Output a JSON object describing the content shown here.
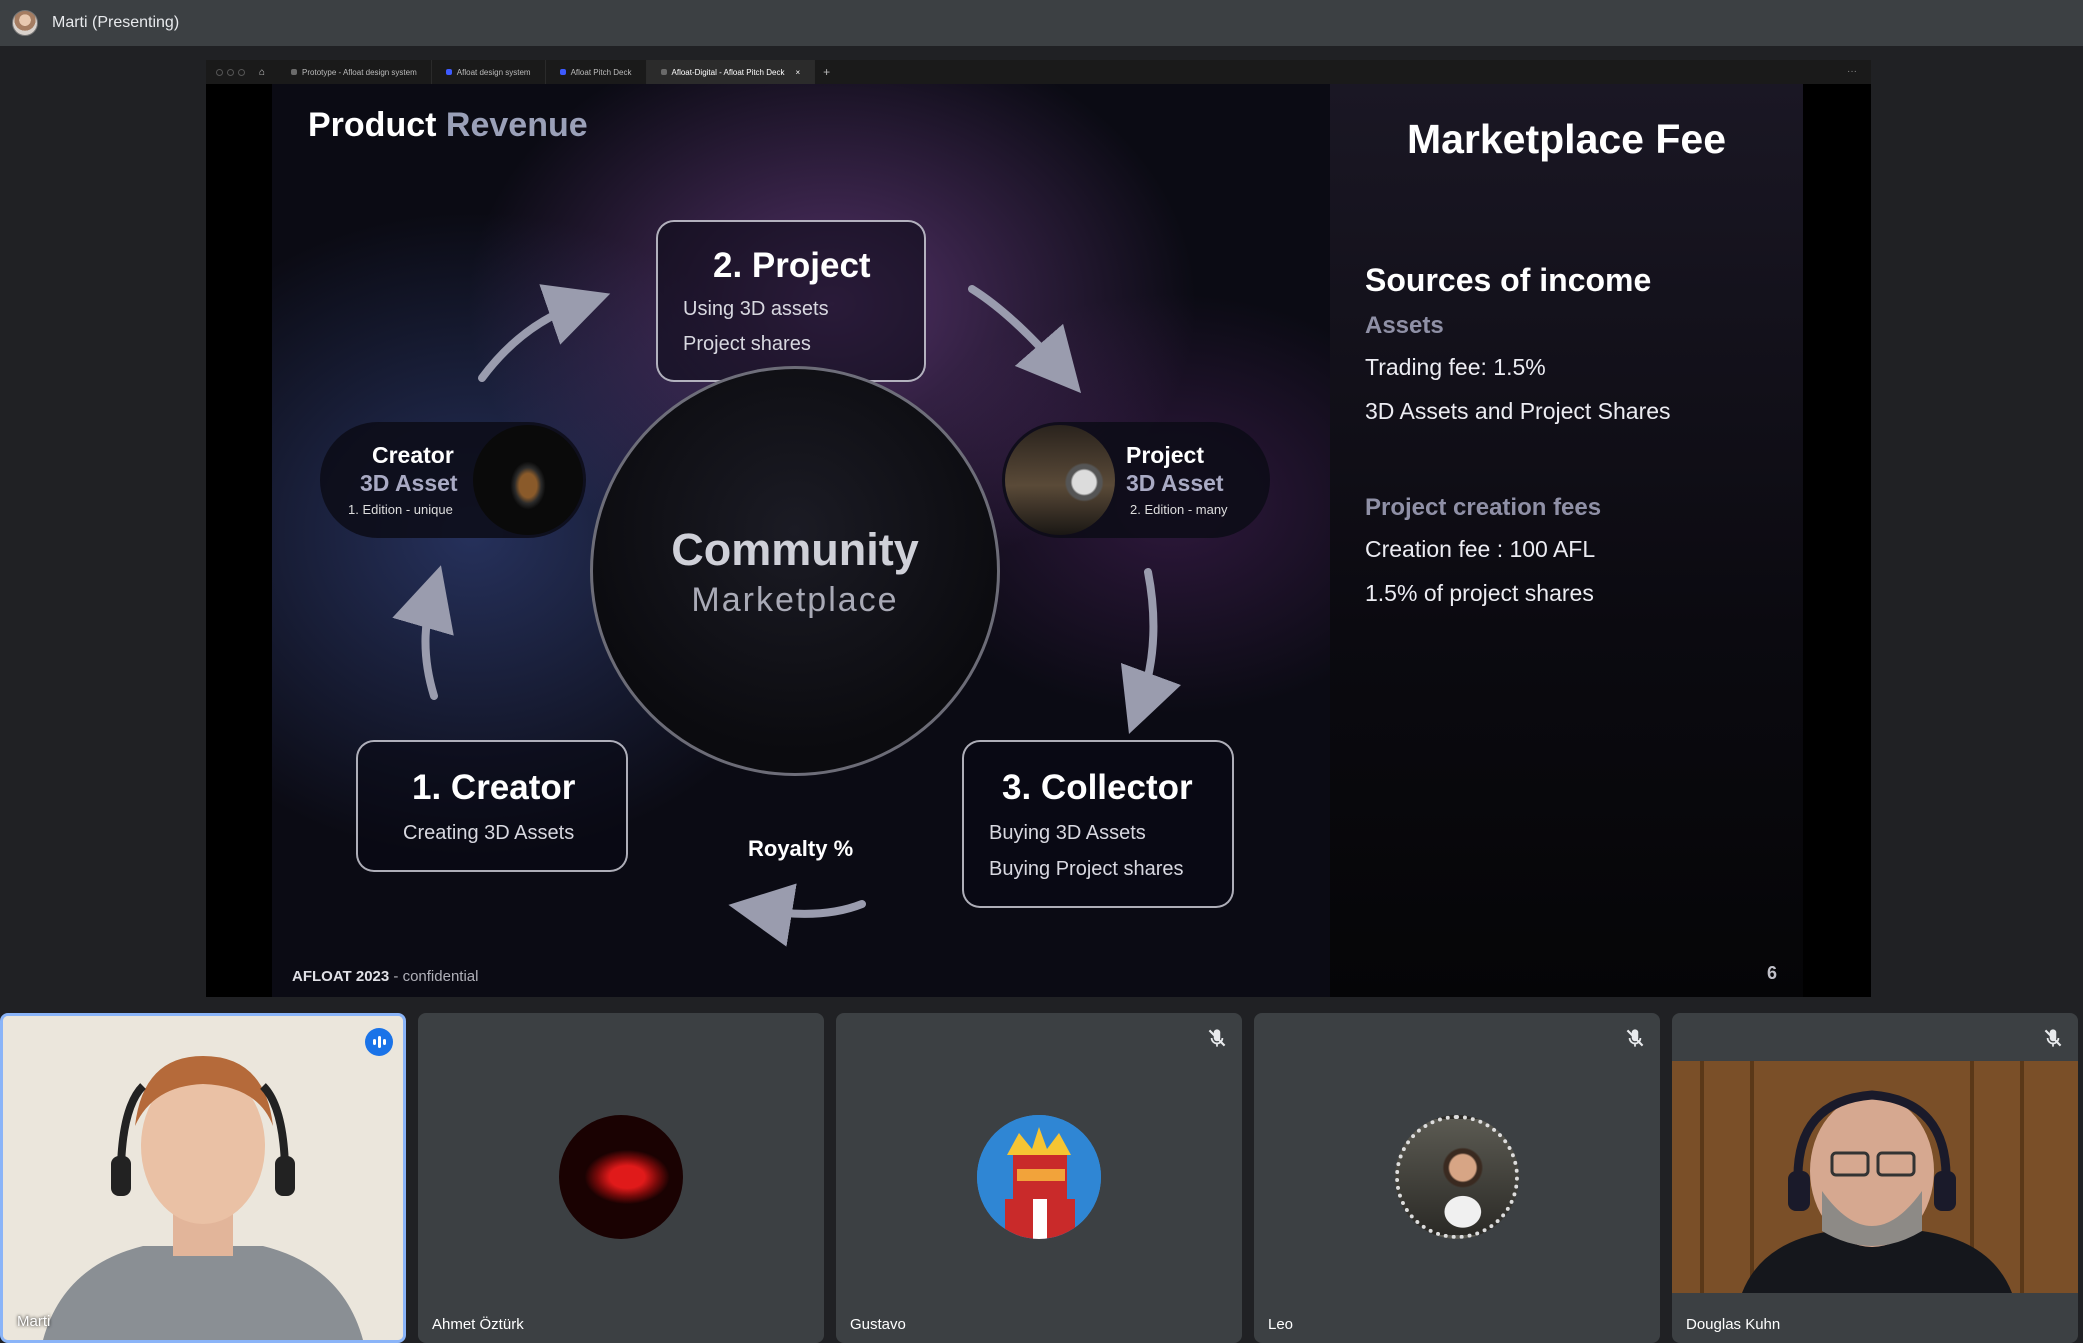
{
  "meeting": {
    "presenter_label": "Marti (Presenting)"
  },
  "browser": {
    "tabs": [
      {
        "label": "Prototype - Afloat design system",
        "active": false
      },
      {
        "label": "Afloat design system",
        "active": false
      },
      {
        "label": "Afloat Pitch Deck",
        "active": false
      },
      {
        "label": "Afloat-Digital - Afloat Pitch Deck",
        "active": true
      }
    ],
    "close_glyph": "×",
    "new_tab_glyph": "+",
    "more_glyph": "···"
  },
  "slide": {
    "title_part1": "Product",
    "title_part2": "Revenue",
    "project_box": {
      "heading": "2. Project",
      "line1": "Using 3D assets",
      "line2": "Project shares"
    },
    "creator_box": {
      "heading": "1. Creator",
      "line1": "Creating 3D Assets"
    },
    "collector_box": {
      "heading": "3. Collector",
      "line1": "Buying 3D Assets",
      "line2": "Buying Project shares"
    },
    "center": {
      "line1": "Community",
      "line2": "Marketplace"
    },
    "creator_pill": {
      "title": "Creator",
      "subtitle": "3D Asset",
      "edition": "1. Edition - unique"
    },
    "project_pill": {
      "title": "Project",
      "subtitle": "3D Asset",
      "edition": "2. Edition - many"
    },
    "royalty": "Royalty %",
    "footer_brand": "AFLOAT 2023",
    "footer_rest": " - confidential",
    "page_number": "6"
  },
  "fee_panel": {
    "title": "Marketplace Fee",
    "heading": "Sources of income",
    "assets_label": "Assets",
    "trading_fee": "Trading fee: 1.5%",
    "assets_desc": "3D Assets and Project Shares",
    "project_label": "Project creation fees",
    "creation_fee": "Creation fee : 100 AFL",
    "project_share": "1.5% of project shares"
  },
  "participants": [
    {
      "name": "Marti",
      "muted": false,
      "speaking": true
    },
    {
      "name": "Ahmet Öztürk",
      "muted": false
    },
    {
      "name": "Gustavo",
      "muted": true
    },
    {
      "name": "Leo",
      "muted": true
    },
    {
      "name": "Douglas Kuhn",
      "muted": true
    }
  ],
  "colors": {
    "accent_blue": "#1a73e8",
    "active_border": "#8ab4f8",
    "tile_bg": "#3c4043"
  }
}
